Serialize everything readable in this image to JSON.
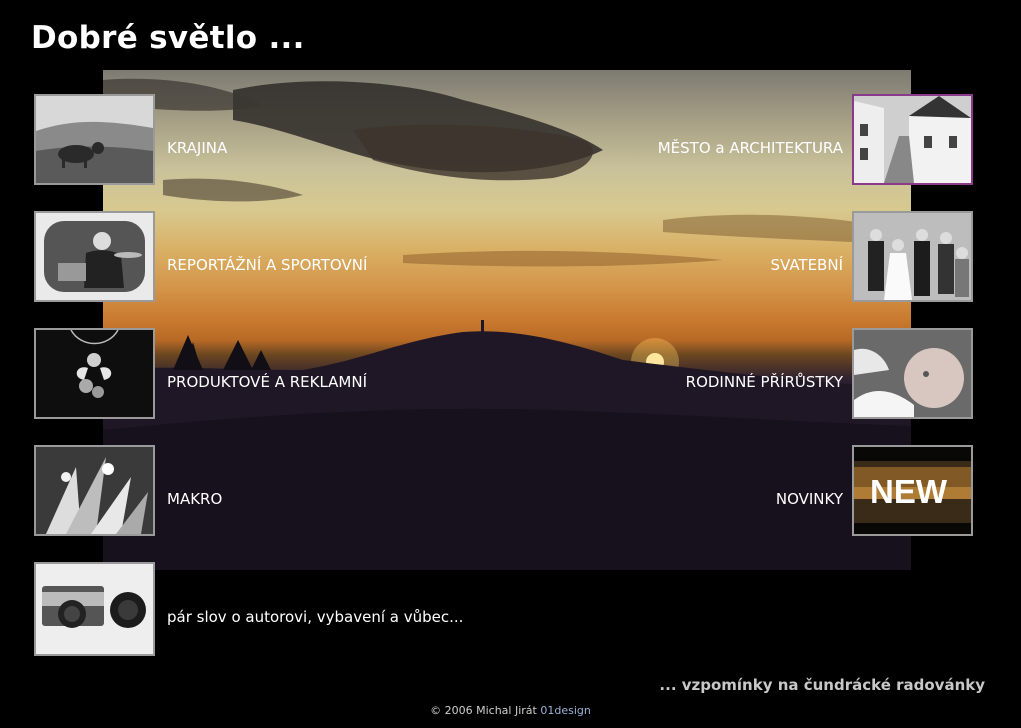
{
  "page": {
    "title": "Dobré světlo ..."
  },
  "left_menu": [
    {
      "label": "KRAJINA"
    },
    {
      "label": "REPORTÁŽNÍ A SPORTOVNÍ"
    },
    {
      "label": "PRODUKTOVÉ A REKLAMNÍ"
    },
    {
      "label": "MAKRO"
    },
    {
      "label": "pár slov o autorovi, vybavení a vůbec..."
    }
  ],
  "right_menu": [
    {
      "label": "MĚSTO a ARCHITEKTURA"
    },
    {
      "label": "SVATEBNÍ"
    },
    {
      "label": "RODINNÉ PŘÍRŮSTKY"
    },
    {
      "label": "NOVINKY",
      "thumb_text": "NEW"
    }
  ],
  "memories_link": "... vzpomínky na čundrácké radovánky",
  "footer": {
    "copyright": "© 2006 Michal Jirát",
    "brand": "01design"
  }
}
